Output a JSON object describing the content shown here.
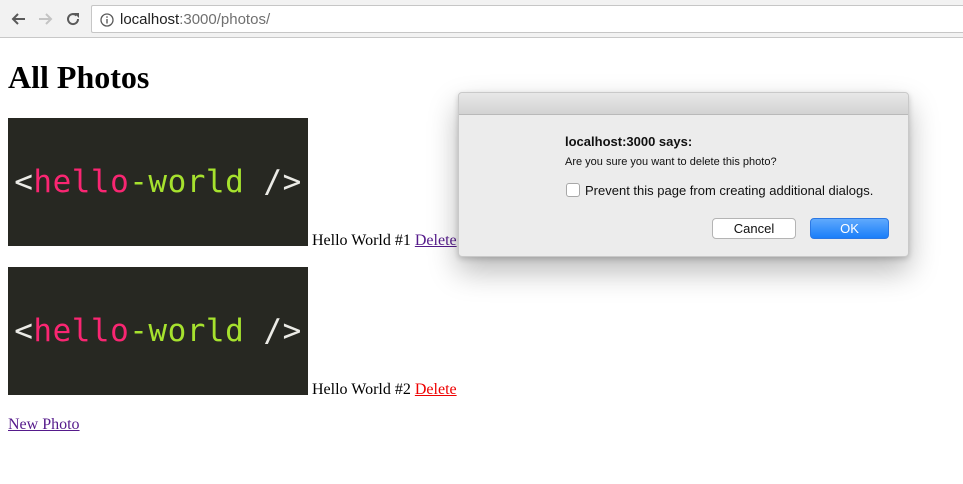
{
  "browser": {
    "url_host": "localhost",
    "url_path": ":3000/photos/"
  },
  "page": {
    "title": "All Photos",
    "photos": [
      {
        "thumb": {
          "open": "<",
          "word1": "hello",
          "dash": "-",
          "word2": "world",
          "close": " />"
        },
        "caption": "Hello World #1",
        "delete_label": "Delete"
      },
      {
        "thumb": {
          "open": "<",
          "word1": "hello",
          "dash": "-",
          "word2": "world",
          "close": " />"
        },
        "caption": "Hello World #2",
        "delete_label": "Delete"
      }
    ],
    "new_photo_label": "New Photo"
  },
  "dialog": {
    "heading": "localhost:3000 says:",
    "message": "Are you sure you want to delete this photo?",
    "checkbox_label": "Prevent this page from creating additional dialogs.",
    "checkbox_checked": false,
    "cancel_label": "Cancel",
    "ok_label": "OK"
  },
  "colors": {
    "link_visited": "#551a8b",
    "link_active": "#ee0000",
    "thumb_bg": "#272822",
    "thumb_pink": "#f92672",
    "thumb_green": "#a6e22e",
    "ok_button": "#1a7ef9"
  }
}
